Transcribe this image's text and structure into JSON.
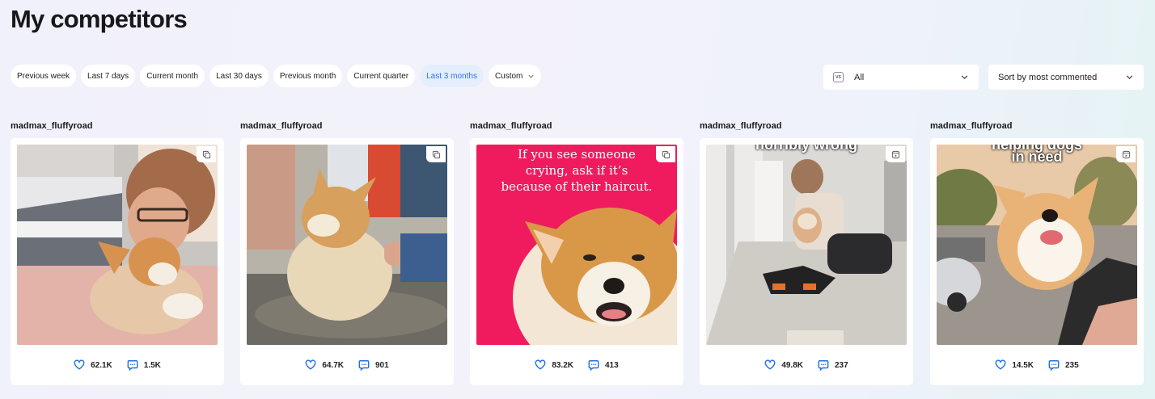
{
  "page": {
    "title": "My competitors"
  },
  "filters": [
    {
      "label": "Previous week",
      "active": false
    },
    {
      "label": "Last 7 days",
      "active": false
    },
    {
      "label": "Current month",
      "active": false
    },
    {
      "label": "Last 30 days",
      "active": false
    },
    {
      "label": "Previous month",
      "active": false
    },
    {
      "label": "Current quarter",
      "active": false
    },
    {
      "label": "Last 3 months",
      "active": true
    },
    {
      "label": "Custom",
      "active": false,
      "dropdown": true
    }
  ],
  "type_select": {
    "icon_text": "VS",
    "value": "All"
  },
  "sort_select": {
    "value": "Sort by most commented"
  },
  "posts": [
    {
      "handle": "madmax_fluffyroad",
      "badge_icon": "carousel-icon",
      "likes": "62.1K",
      "comments": "1.5K"
    },
    {
      "handle": "madmax_fluffyroad",
      "badge_icon": "carousel-icon",
      "likes": "64.7K",
      "comments": "901"
    },
    {
      "handle": "madmax_fluffyroad",
      "badge_icon": "carousel-icon",
      "likes": "83.2K",
      "comments": "413",
      "overlay": "If you see someone crying, ask if it’s because of their haircut."
    },
    {
      "handle": "madmax_fluffyroad",
      "badge_icon": "reel-icon",
      "likes": "49.8K",
      "comments": "237",
      "overlay": "horribly wrong"
    },
    {
      "handle": "madmax_fluffyroad",
      "badge_icon": "reel-icon",
      "likes": "14.5K",
      "comments": "235",
      "overlay_top": "helping dogs",
      "overlay": "in need"
    }
  ],
  "colors": {
    "accent": "#2f74e8",
    "active_chip_bg": "#e4eefd",
    "card": "#ffffff",
    "icon_blue": "#1f6fe5"
  }
}
